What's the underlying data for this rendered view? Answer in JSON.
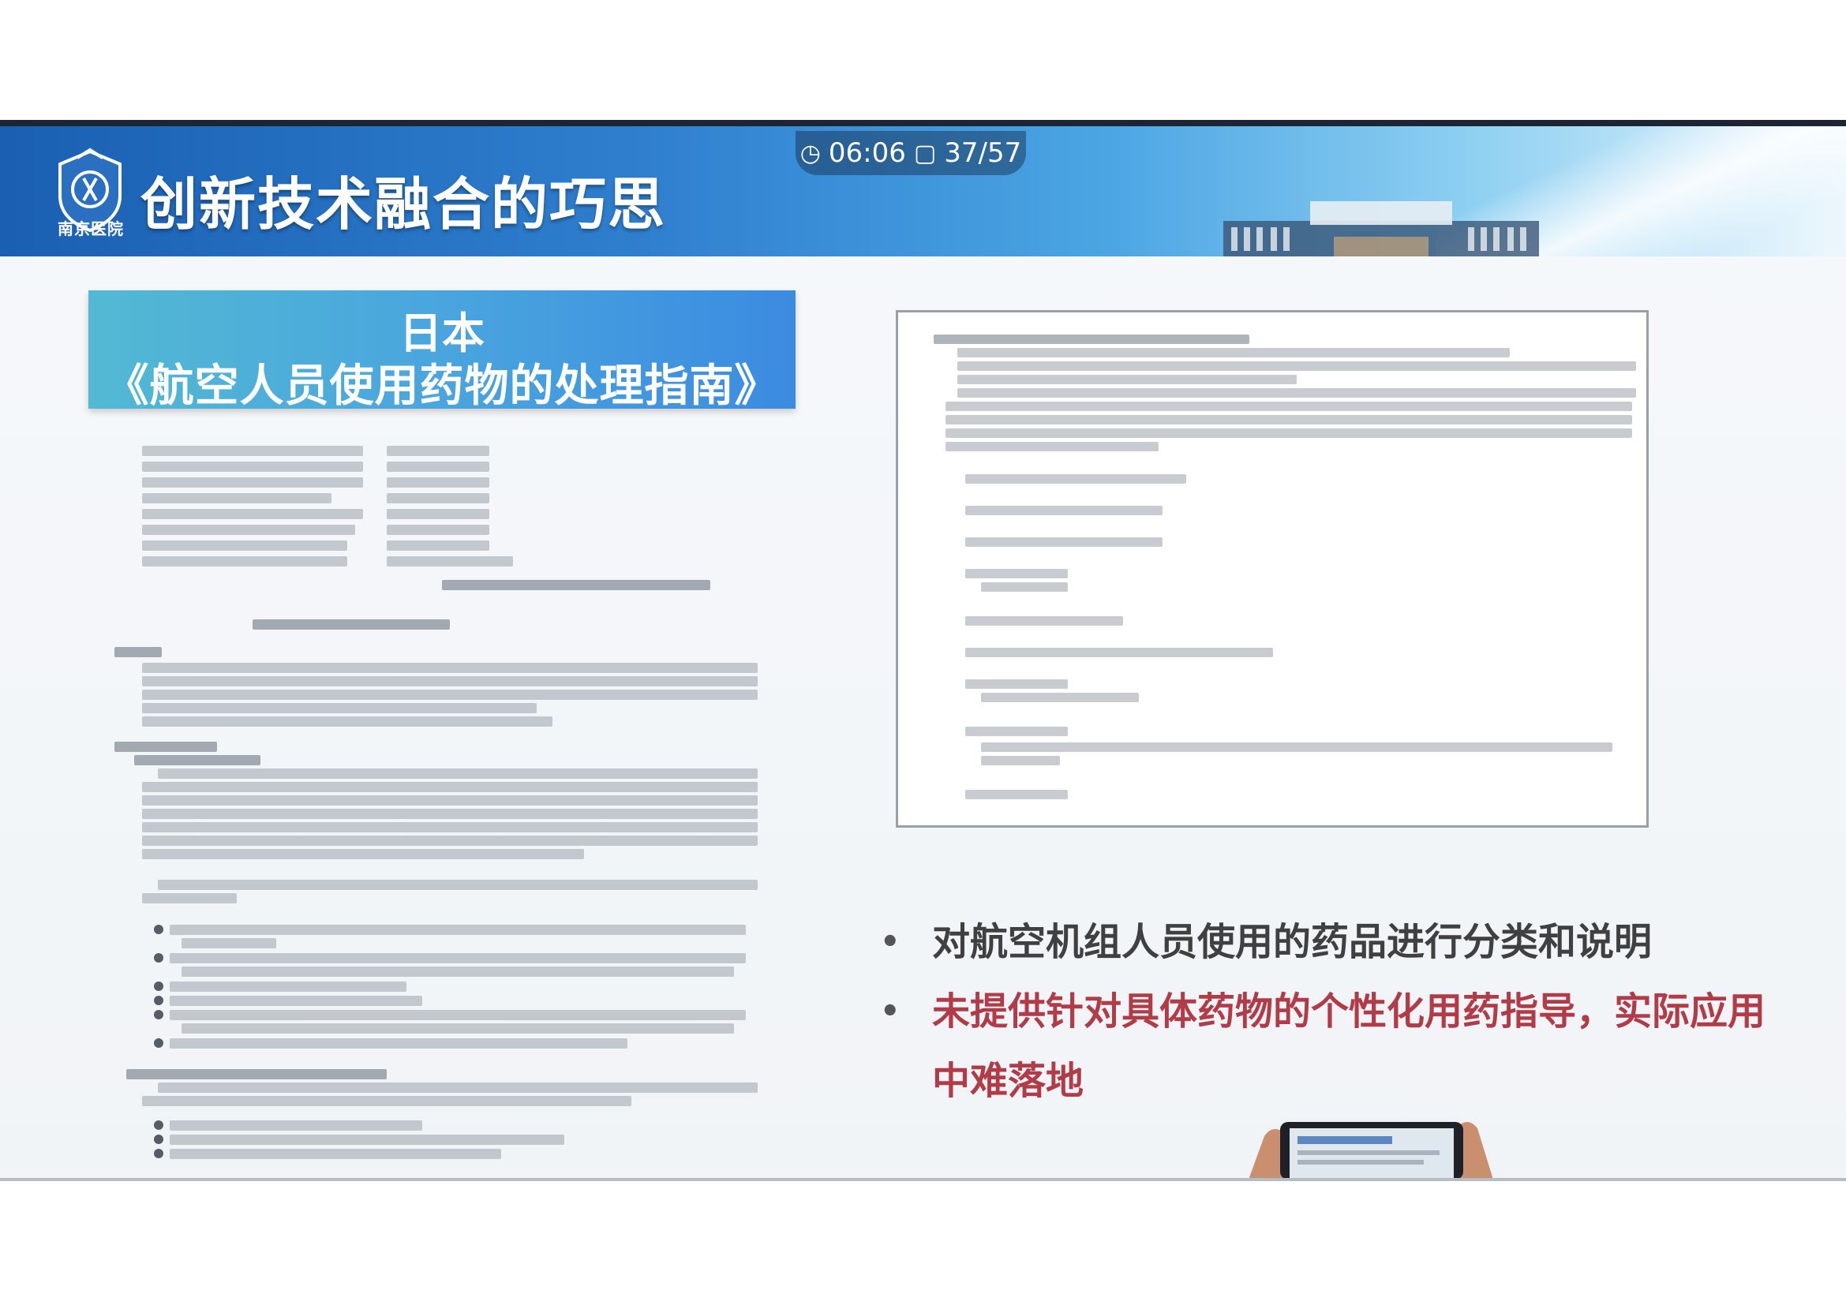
{
  "header": {
    "title": "创新技术融合的巧思",
    "logo_text": "南京医院",
    "timer": "06:06",
    "page": "37/57"
  },
  "left_banner": {
    "line1": "日本",
    "line2": "《航空人员使用药物的处理指南》"
  },
  "bullets": [
    {
      "text": "对航空机组人员使用的药品进行分类和说明",
      "color": "#404040"
    },
    {
      "text": "未提供针对具体药物的个性化用药指导，实际应用中难落地",
      "color": "#b23b48"
    }
  ],
  "icons": {
    "timer": "clock-icon",
    "page": "page-icon",
    "logo": "hospital-logo-icon"
  },
  "colors": {
    "header_start": "#1a5fb2",
    "banner": "#4aa5de",
    "highlight_red": "#b23b48"
  }
}
